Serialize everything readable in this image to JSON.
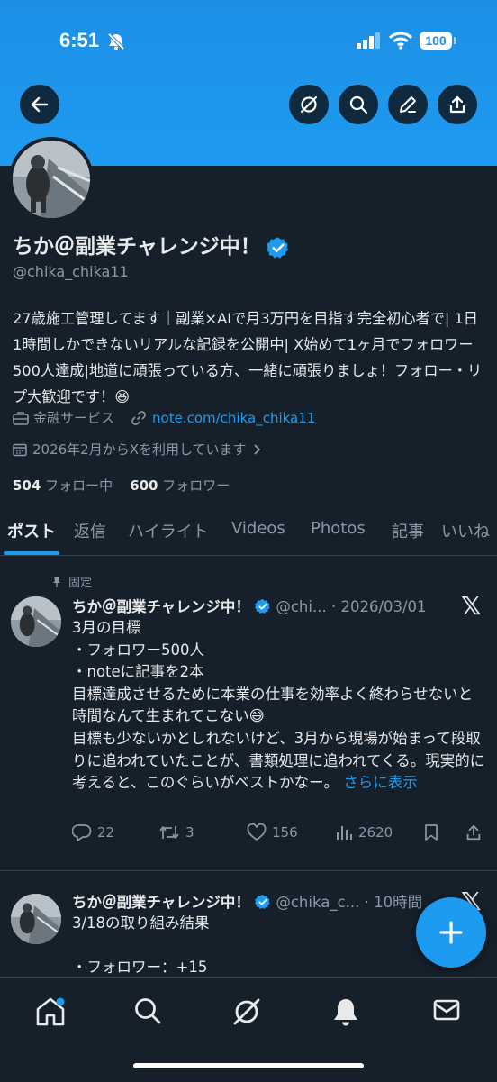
{
  "status_bar": {
    "time": "6:51",
    "battery": "100"
  },
  "profile": {
    "name": "ちか＠副業チャレンジ中！",
    "handle": "@chika_chika11",
    "bio": "27歳施工管理してます｜副業×AIで月3万円を目指す完全初心者で| 1日1時間しかできないリアルな記録を公開中| X始めて1ヶ月でフォロワー500人達成|地道に頑張っている方、一緒に頑張りましょ！フォロー・リプ大歓迎です！😆",
    "category": "金融サービス",
    "link": "note.com/chika_chika11",
    "joined": "2026年2月からXを利用しています",
    "following_count": "504",
    "following_label": "フォロー中",
    "followers_count": "600",
    "followers_label": "フォロワー"
  },
  "tabs": [
    {
      "label": "ポスト"
    },
    {
      "label": "返信"
    },
    {
      "label": "ハイライト"
    },
    {
      "label": "Videos"
    },
    {
      "label": "Photos"
    },
    {
      "label": "記事"
    },
    {
      "label": "いいね"
    }
  ],
  "posts": [
    {
      "pinned_label": "固定",
      "name": "ちか＠副業チャレンジ中！",
      "handle": "@chi...",
      "sep": "·",
      "date": "2026/03/01",
      "body": "3月の目標\n・フォロワー500人\n・noteに記事を2本\n目標達成させるために本業の仕事を効率よく終わらせないと時間なんて生まれてこない😅\n目標も少ないかとしれないけど、3月から現場が始まって段取りに追われていたことが、書類処理に追われてくる。現実的に考えると、このぐらいがベストかなー。",
      "more": "さらに表示",
      "replies": "22",
      "reposts": "3",
      "likes": "156",
      "views": "2620"
    },
    {
      "name": "ちか＠副業チャレンジ中！",
      "handle": "@chika_c...",
      "sep": "·",
      "date": "10時間",
      "body": "3/18の取り組み結果\n\n・フォロワー：+15"
    }
  ],
  "colors": {
    "accent": "#1d9bf0",
    "background": "#15202b",
    "secondary_text": "#8b98a5"
  },
  "icons": {
    "header": [
      "back-arrow-icon",
      "grok-icon",
      "search-icon",
      "edit-icon",
      "share-icon"
    ],
    "nav": [
      "home-icon",
      "search-icon",
      "grok-icon",
      "notifications-icon",
      "messages-icon"
    ]
  }
}
